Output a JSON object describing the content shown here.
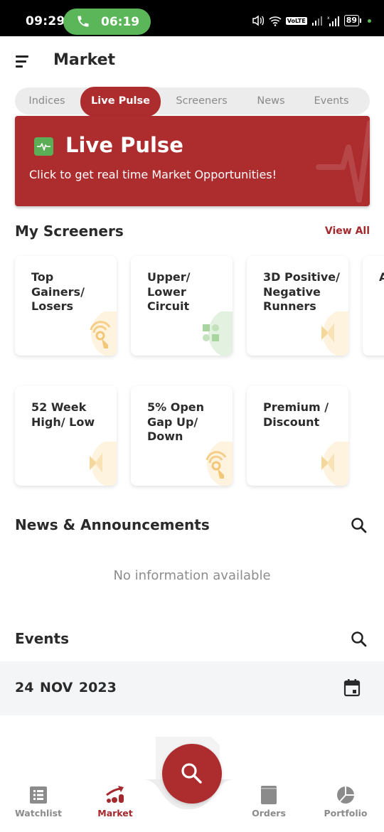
{
  "status_bar": {
    "time": "09:29",
    "call_timer": "06:19",
    "battery": "89",
    "network_label": "VoLTE"
  },
  "header": {
    "title": "Market"
  },
  "tabs": [
    {
      "label": "Indices",
      "active": false
    },
    {
      "label": "Live Pulse",
      "active": true
    },
    {
      "label": "Screeners",
      "active": false
    },
    {
      "label": "News",
      "active": false
    },
    {
      "label": "Events",
      "active": false
    }
  ],
  "banner": {
    "title": "Live Pulse",
    "subtitle": "Click to get real time Market Opportunities!"
  },
  "screeners": {
    "title": "My Screeners",
    "view_all": "View All",
    "cards": [
      {
        "label": "Top Gainers/ Losers",
        "icon": "touch-icon"
      },
      {
        "label": "Upper/ Lower Circuit",
        "icon": "grid-icon"
      },
      {
        "label": "3D Positive/ Negative Runners",
        "icon": "bowtie-icon"
      },
      {
        "label": "A D",
        "icon": "bowtie-icon"
      },
      {
        "label": "52 Week High/ Low",
        "icon": "bowtie-icon"
      },
      {
        "label": "5% Open Gap Up/ Down",
        "icon": "touch-icon"
      },
      {
        "label": "Premium / Discount",
        "icon": "bowtie-icon"
      }
    ]
  },
  "news": {
    "title": "News & Announcements",
    "empty_text": "No information available"
  },
  "events": {
    "title": "Events",
    "date": "24 NOV  2023"
  },
  "bottom_nav": [
    {
      "label": "Watchlist",
      "icon": "list-icon",
      "active": false
    },
    {
      "label": "Market",
      "icon": "market-trend-icon",
      "active": true
    },
    {
      "label": "Orders",
      "icon": "orders-book-icon",
      "active": false
    },
    {
      "label": "Portfolio",
      "icon": "pie-chart-icon",
      "active": false
    }
  ],
  "colors": {
    "brand": "#ad2d2f",
    "accent_text": "#a4282c",
    "call_green": "#5bb65a",
    "inactive": "#8b8b8b"
  }
}
